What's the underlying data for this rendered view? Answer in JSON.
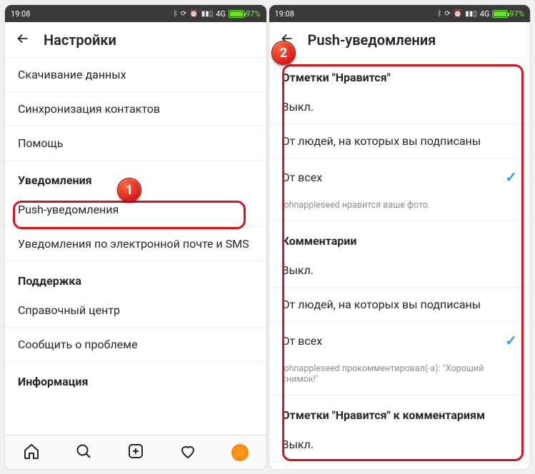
{
  "status_bar": {
    "time": "19:08",
    "network_label": "4G",
    "battery_percent": "97%"
  },
  "callouts": {
    "one": "1",
    "two": "2"
  },
  "left_screen": {
    "title": "Настройки",
    "items": {
      "download_data": "Скачивание данных",
      "sync_contacts": "Синхронизация контактов",
      "help": "Помощь"
    },
    "sections": {
      "notifications_header": "Уведомления",
      "push_notifications": "Push-уведомления",
      "email_sms": "Уведомления по электронной почте и SMS",
      "support_header": "Поддержка",
      "help_center": "Справочный центр",
      "report_problem": "Сообщить о проблеме",
      "info_header": "Информация"
    }
  },
  "right_screen": {
    "title": "Push-уведомления",
    "likes": {
      "header": "Отметки \"Нравится\"",
      "off": "Выкл.",
      "from_following": "От людей, на которых вы подписаны",
      "from_everyone": "От всех",
      "hint": "johnappleseed нравится ваше фото."
    },
    "comments": {
      "header": "Комментарии",
      "off": "Выкл.",
      "from_following": "От людей, на которых вы подписаны",
      "from_everyone": "От всех",
      "hint": "johnappleseed прокомментировал(-а): \"Хороший снимок!\""
    },
    "comment_likes": {
      "header": "Отметки \"Нравится\" к комментариям",
      "off": "Выкл."
    }
  }
}
